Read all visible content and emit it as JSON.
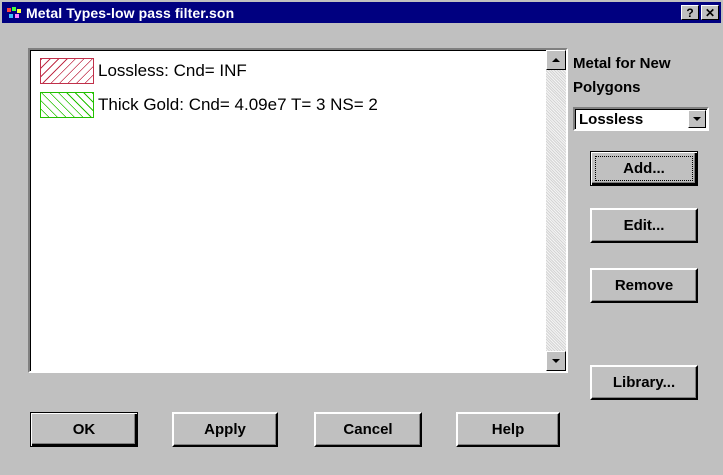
{
  "window": {
    "title": "Metal Types-low pass filter.son",
    "help_button": "?",
    "close_button": "✕"
  },
  "metal_list": {
    "items": [
      {
        "label": "Lossless:  Cnd= INF",
        "swatch_color": "#c0304a",
        "hatch": "back-diagonal"
      },
      {
        "label": "Thick Gold:  Cnd= 4.09e7 T= 3 NS= 2",
        "swatch_color": "#22c000",
        "hatch": "forward-diagonal"
      }
    ]
  },
  "new_polygon_metal": {
    "label": "Metal for New Polygons",
    "selected": "Lossless"
  },
  "side_buttons": {
    "add": "Add...",
    "edit": "Edit...",
    "remove": "Remove",
    "library": "Library..."
  },
  "bottom_buttons": {
    "ok": "OK",
    "apply": "Apply",
    "cancel": "Cancel",
    "help": "Help"
  }
}
